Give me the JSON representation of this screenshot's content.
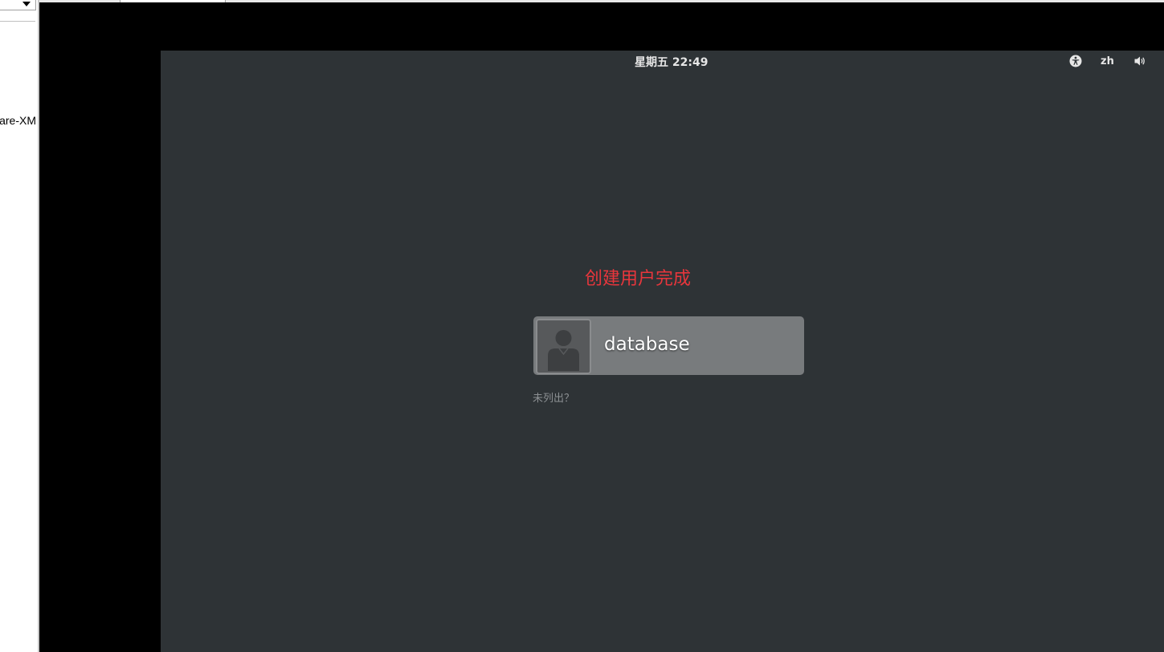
{
  "host": {
    "sidebar_item_label": "are-XM"
  },
  "gdm": {
    "topbar": {
      "clock": "星期五 22:49",
      "language": "zh",
      "accessibility_icon": "accessibility-icon",
      "volume_icon": "volume-icon"
    },
    "status_message": "创建用户完成",
    "users": [
      {
        "name": "database",
        "avatar_icon": "user-avatar-icon"
      }
    ],
    "not_listed_label": "未列出？"
  },
  "colors": {
    "status_message": "#e8363c",
    "background": "#2e3336",
    "user_card": "#787b7d"
  }
}
